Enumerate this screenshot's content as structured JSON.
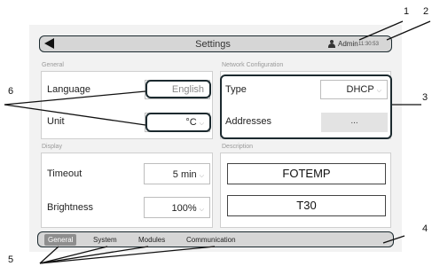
{
  "header": {
    "title": "Settings",
    "user": "Admin",
    "time": "11:30:53"
  },
  "general": {
    "section": "General",
    "language_label": "Language",
    "language_value": "English",
    "unit_label": "Unit",
    "unit_value": "°C"
  },
  "network": {
    "section": "Network Configuration",
    "type_label": "Type",
    "type_value": "DHCP",
    "addresses_label": "Addresses",
    "addresses_button": "..."
  },
  "display": {
    "section": "Display",
    "timeout_label": "Timeout",
    "timeout_value": "5 min",
    "brightness_label": "Brightness",
    "brightness_value": "100%"
  },
  "description": {
    "section": "Description",
    "line1": "FOTEMP",
    "line2": "T30"
  },
  "tabs": [
    "General",
    "System",
    "Modules",
    "Communication"
  ],
  "callouts": [
    "1",
    "2",
    "3",
    "4",
    "5",
    "6"
  ]
}
